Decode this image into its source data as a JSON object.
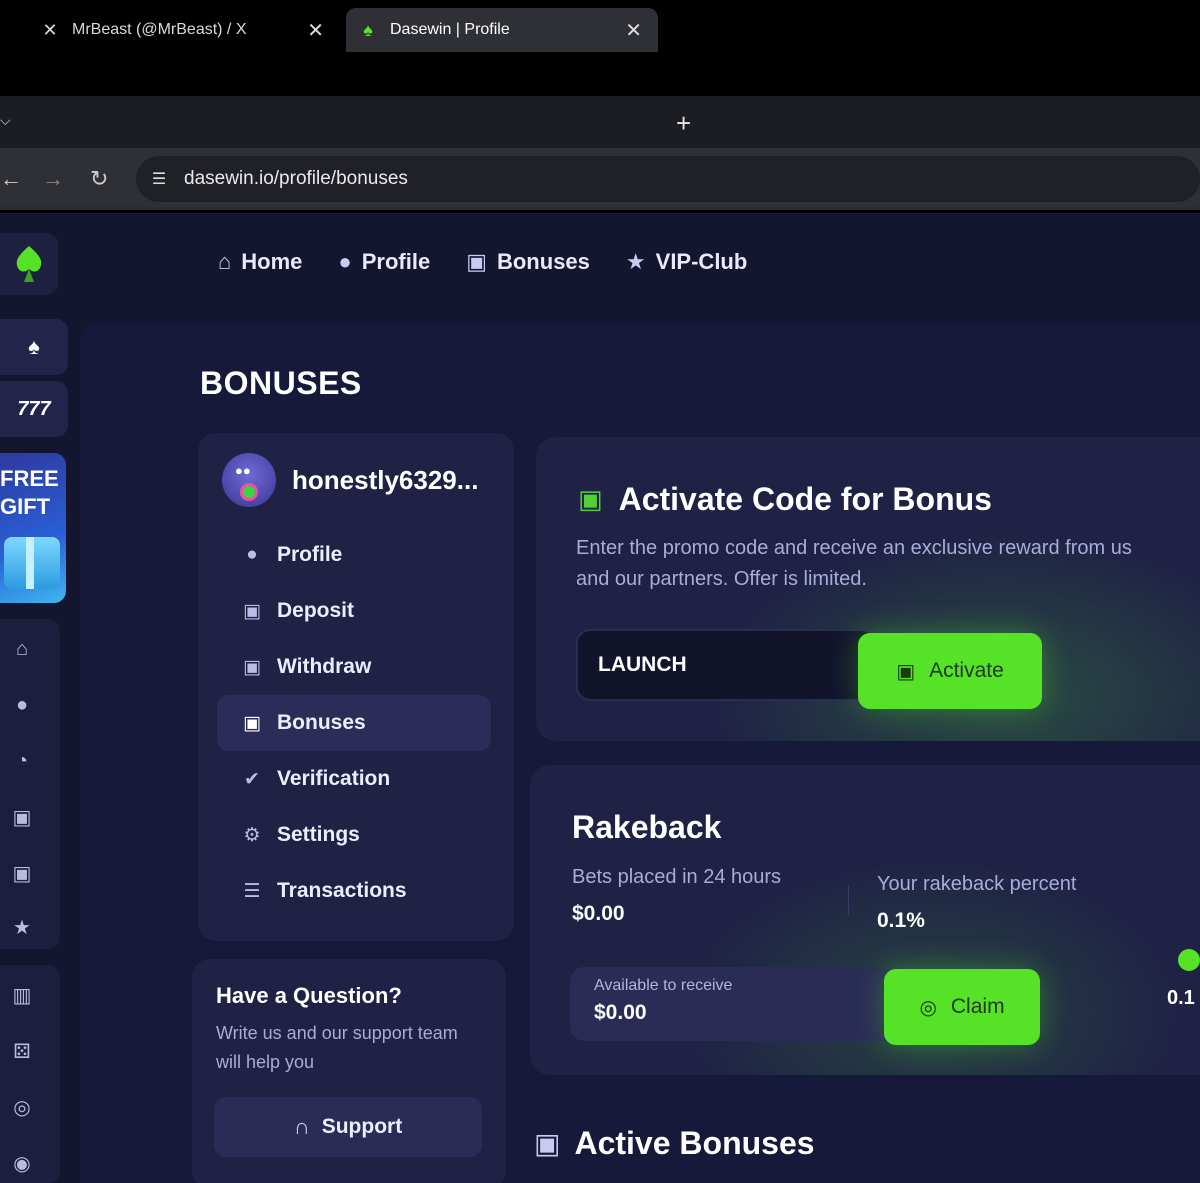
{
  "browser": {
    "tabs": [
      {
        "title": "MrBeast (@MrBeast) / X",
        "favicon": "x-logo-icon"
      },
      {
        "title": "Dasewin | Profile",
        "favicon": "dasewin-logo-icon"
      }
    ],
    "url": "dasewin.io/profile/bonuses"
  },
  "sidebar": {
    "promo": {
      "line1": "FREE",
      "line2": "GIFT"
    },
    "slots_label": "777"
  },
  "topnav": [
    {
      "label": "Home",
      "icon": "home-icon"
    },
    {
      "label": "Profile",
      "icon": "user-icon"
    },
    {
      "label": "Bonuses",
      "icon": "gift-icon"
    },
    {
      "label": "VIP-Club",
      "icon": "star-icon"
    }
  ],
  "page": {
    "title": "BONUSES"
  },
  "user": {
    "name": "honestly6329..."
  },
  "menu": [
    {
      "label": "Profile",
      "icon": "user-icon"
    },
    {
      "label": "Deposit",
      "icon": "wallet-in-icon"
    },
    {
      "label": "Withdraw",
      "icon": "wallet-out-icon"
    },
    {
      "label": "Bonuses",
      "icon": "gift-icon",
      "active": true
    },
    {
      "label": "Verification",
      "icon": "badge-check-icon"
    },
    {
      "label": "Settings",
      "icon": "gear-icon"
    },
    {
      "label": "Transactions",
      "icon": "list-icon"
    }
  ],
  "question": {
    "title": "Have a Question?",
    "text": "Write us and our support team will help you",
    "button": "Support"
  },
  "activate": {
    "title": "Activate Code for Bonus",
    "description": "Enter the promo code and receive an exclusive reward from us and our partners. Offer is limited.",
    "code_value": "LAUNCH",
    "button": "Activate"
  },
  "rakeback": {
    "title": "Rakeback",
    "bets_label": "Bets placed in 24 hours",
    "bets_value": "$0.00",
    "percent_label": "Your rakeback percent",
    "percent_value": "0.1%",
    "available_label": "Available to receive",
    "available_value": "$0.00",
    "claim_button": "Claim",
    "edge_value": "0.1"
  },
  "active_bonuses": {
    "title": "Active Bonuses"
  },
  "colors": {
    "accent": "#55e227",
    "background": "#141630",
    "card": "#1f2145"
  }
}
